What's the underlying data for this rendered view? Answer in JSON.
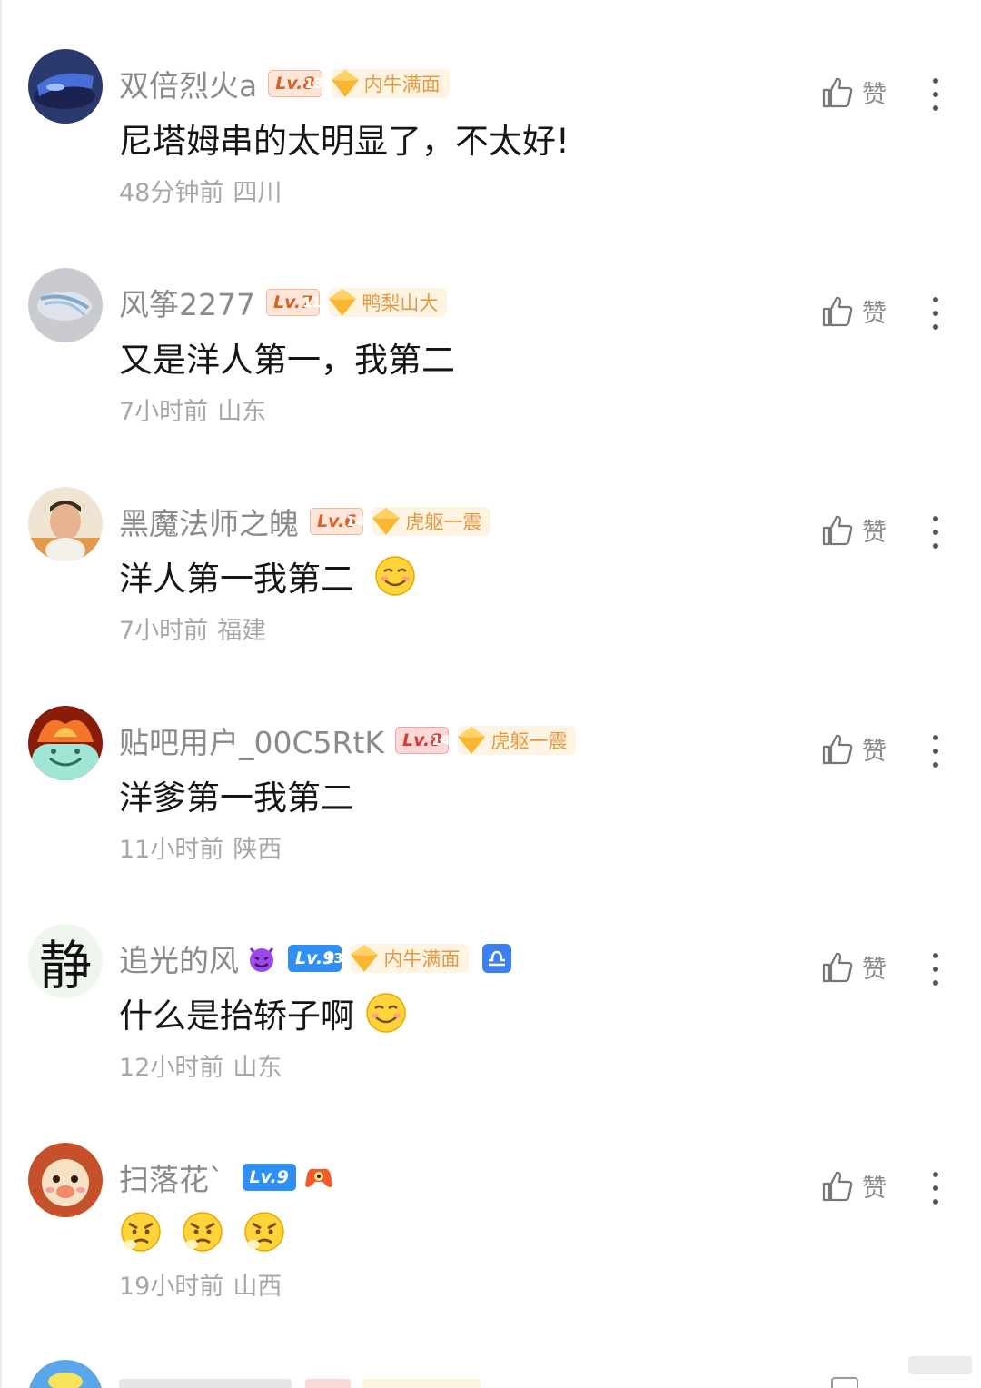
{
  "like_label": "赞",
  "comments": [
    {
      "username": "双倍烈火a",
      "level": "Lv.8",
      "badge_number": "13",
      "badge_label": "内牛满面",
      "text": "尼塔姆串的太明显了，不太好!",
      "time": "48分钟前",
      "location": "四川"
    },
    {
      "username": "风筝2277",
      "level": "Lv.7",
      "badge_number": "11",
      "badge_label": "鸭梨山大",
      "text": "又是洋人第一，我第二",
      "time": "7小时前",
      "location": "山东"
    },
    {
      "username": "黑魔法师之魄",
      "level": "Lv.6",
      "badge_number": "14",
      "badge_label": "虎躯一震",
      "text": "洋人第一我第二",
      "time": "7小时前",
      "location": "福建"
    },
    {
      "username": "贴吧用户_00C5RtK",
      "level": "Lv.8",
      "badge_number": "14",
      "badge_label": "虎躯一震",
      "text": "洋爹第一我第二",
      "time": "11小时前",
      "location": "陕西"
    },
    {
      "username": "追光的风",
      "level": "Lv.9",
      "badge_number": "13",
      "badge_label": "内牛满面",
      "avatar_char": "静",
      "text": "什么是抬轿子啊",
      "time": "12小时前",
      "location": "山东"
    },
    {
      "username": "扫落花`",
      "level": "Lv.9",
      "text": "",
      "time": "19小时前",
      "location": "山西"
    }
  ]
}
